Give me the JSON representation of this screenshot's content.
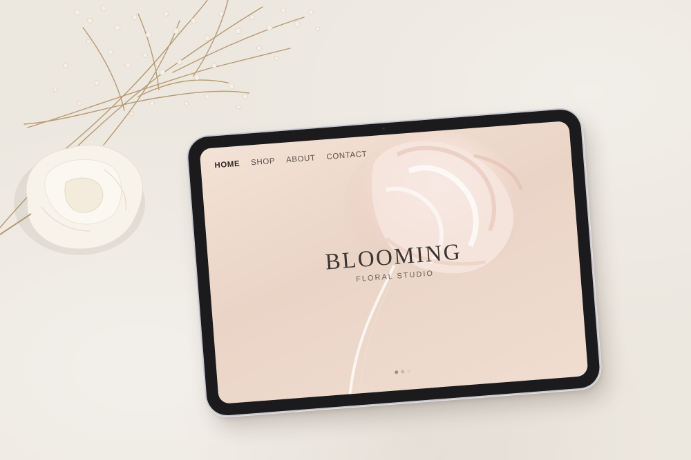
{
  "nav": {
    "items": [
      {
        "label": "HOME",
        "active": true
      },
      {
        "label": "SHOP",
        "active": false
      },
      {
        "label": "ABOUT",
        "active": false
      },
      {
        "label": "CONTACT",
        "active": false
      }
    ]
  },
  "hero": {
    "title": "BLOOMING",
    "subtitle": "FLORAL STUDIO"
  },
  "pager": {
    "count": 3,
    "active_index": 0
  },
  "colors": {
    "background": "#ece7df",
    "screen": "#efdcd0",
    "text_dark": "#3b3330",
    "accent_dot": "#a98a7c"
  },
  "icons": [
    "tulip-illustration",
    "dried-gypsophila-decor",
    "white-flower-decor"
  ]
}
